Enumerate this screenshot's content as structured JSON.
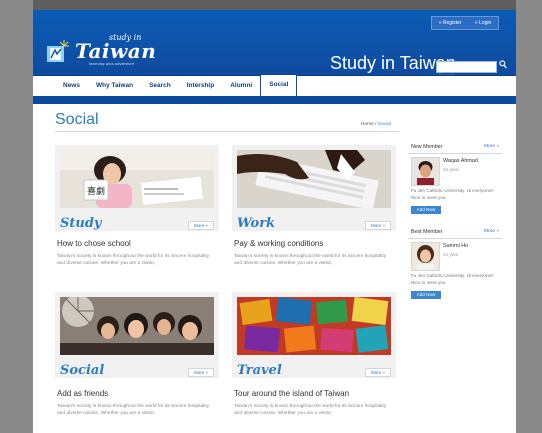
{
  "site": {
    "logo_small": "study in",
    "logo_main": "Taiwan",
    "logo_tagline": "learning plus adventure",
    "header_title": "Study in Taiwan",
    "search_placeholder": "Search"
  },
  "top_links": [
    "» Register",
    "» Login"
  ],
  "nav": [
    "News",
    "Why Taiwan",
    "Search",
    "Intership",
    "Alumni",
    "Social"
  ],
  "nav_active": "Social",
  "page": {
    "title": "Social",
    "breadcrumb_home": "Home",
    "breadcrumb_sep": " / ",
    "breadcrumb_current": "Social"
  },
  "cards": [
    {
      "band_title": "Study",
      "more": "More »",
      "heading": "How to chose school",
      "text": "Taiwan's society is known throughout the world for its sincere hospitality and diverse cuisine. Whether you are a visitor,"
    },
    {
      "band_title": "Work",
      "more": "More »",
      "heading": "Pay & working conditions",
      "text": "Taiwan's society is known throughout the world for its sincere hospitality and diverse cuisine. Whether you are a visitor,"
    },
    {
      "band_title": "Social",
      "more": "More »",
      "heading": "Add as friends",
      "text": "Taiwan's society is known throughout the world for its sincere hospitality and diverse cuisine. Whether you are a visitor,"
    },
    {
      "band_title": "Travel",
      "more": "More »",
      "heading": "Tour around the island of Taiwan",
      "text": "Taiwan's society is known throughout the world for its sincere hospitality and diverse cuisine. Whether you are a visitor,"
    }
  ],
  "sidebar": [
    {
      "title": "New Member",
      "more": "More »",
      "name": "Waqas Ahmad",
      "age": "24 year",
      "desc": "Fu Jen Catholic University. Hi everyone!! Nice to meet you",
      "add_label": "Add Now"
    },
    {
      "title": "Best Member",
      "more": "More »",
      "name": "Sammi Ho",
      "age": "22 year",
      "desc": "Fu Jen Catholic University. Hi everyone!! Nice to meet you",
      "add_label": "Add Now"
    }
  ],
  "colors": {
    "header_blue": "#0c4a9c",
    "accent_blue": "#2f7bc0",
    "nav_text": "#173e7c"
  }
}
